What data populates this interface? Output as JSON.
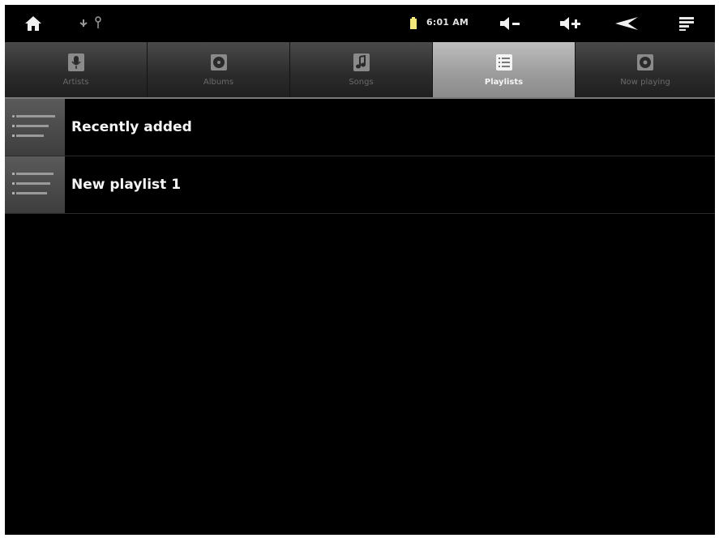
{
  "status_bar": {
    "time": "6:01 AM",
    "icons": [
      "home-icon",
      "usb-icon",
      "debug-icon",
      "battery-icon",
      "volume-down-icon",
      "volume-up-icon",
      "back-icon",
      "menu-icon"
    ]
  },
  "tabs": [
    {
      "label": "Artists",
      "icon": "microphone-icon",
      "active": false
    },
    {
      "label": "Albums",
      "icon": "album-icon",
      "active": false
    },
    {
      "label": "Songs",
      "icon": "music-note-icon",
      "active": false
    },
    {
      "label": "Playlists",
      "icon": "playlist-icon",
      "active": true
    },
    {
      "label": "Now playing",
      "icon": "now-playing-icon",
      "active": false
    }
  ],
  "playlists": [
    {
      "title": "Recently added",
      "icon": "playlist-thumbnail-icon"
    },
    {
      "title": "New playlist 1",
      "icon": "playlist-thumbnail-icon"
    }
  ],
  "colors": {
    "background": "#000000",
    "active_tab": "#a8a8a8",
    "text": "#f5f5f5"
  }
}
